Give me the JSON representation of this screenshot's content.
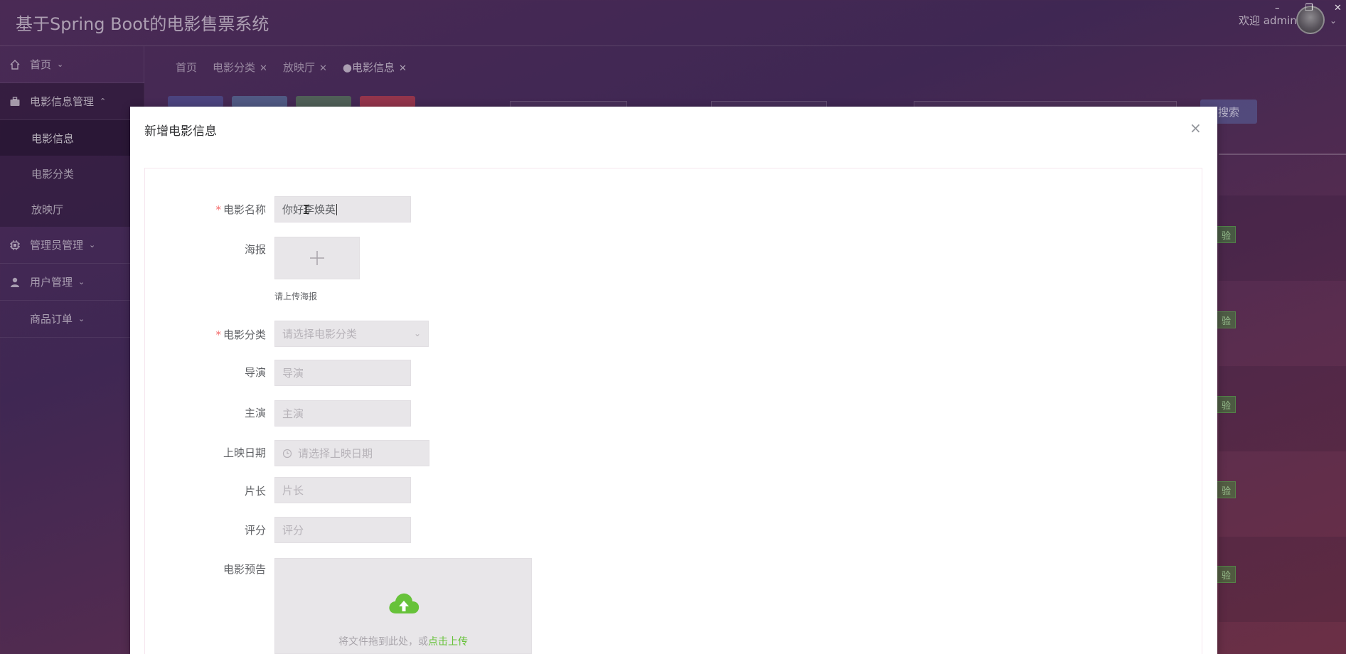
{
  "header": {
    "app_title": "基于Spring Boot的电影售票系统",
    "welcome": "欢迎 admin"
  },
  "sidebar": {
    "items": [
      {
        "label": "首页",
        "icon": "home-icon"
      },
      {
        "label": "电影信息管理",
        "icon": "briefcase-icon"
      },
      {
        "label": "管理员管理",
        "icon": "chip-icon"
      },
      {
        "label": "用户管理",
        "icon": "user-icon"
      },
      {
        "label": "商品订单",
        "icon": "none"
      }
    ],
    "sub_items": [
      "电影信息",
      "电影分类",
      "放映厅"
    ]
  },
  "tabs": [
    {
      "label": "首页"
    },
    {
      "label": "电影分类"
    },
    {
      "label": "放映厅"
    },
    {
      "label": "●电影信息"
    }
  ],
  "toolbar": {
    "search_label": "搜索"
  },
  "row_tags": [
    "验证",
    "验证",
    "验证",
    "验证",
    "验证"
  ],
  "dialog": {
    "title": "新增电影信息",
    "fields": {
      "name": {
        "label": "电影名称",
        "value": "你好李焕英",
        "required": true
      },
      "poster": {
        "label": "海报",
        "tip": "请上传海报"
      },
      "category": {
        "label": "电影分类",
        "placeholder": "请选择电影分类",
        "required": true
      },
      "director": {
        "label": "导演",
        "placeholder": "导演"
      },
      "actors": {
        "label": "主演",
        "placeholder": "主演"
      },
      "release_date": {
        "label": "上映日期",
        "placeholder": "请选择上映日期"
      },
      "duration": {
        "label": "片长",
        "placeholder": "片长"
      },
      "rating": {
        "label": "评分",
        "placeholder": "评分"
      },
      "trailer": {
        "label": "电影预告",
        "upload_text": "将文件拖到此处，或",
        "upload_link": "点击上传"
      }
    }
  },
  "colors": {
    "required": "#f56c6c",
    "upload_link": "#67c23a",
    "input_bg": "#e8e6e9"
  }
}
